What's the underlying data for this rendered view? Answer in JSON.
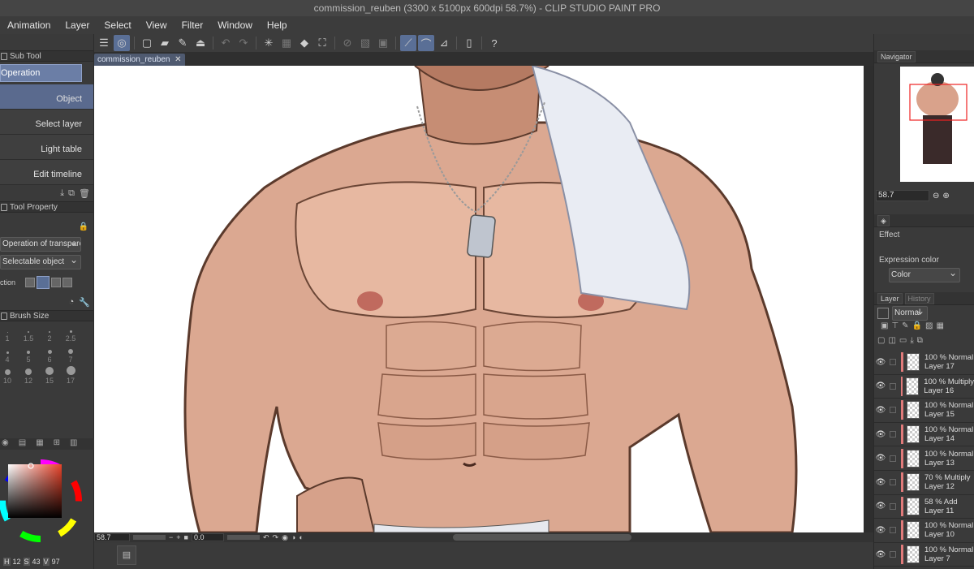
{
  "window": {
    "title": "commission_reuben (3300 x 5100px 600dpi 58.7%) - CLIP STUDIO PAINT PRO"
  },
  "menu": [
    "Animation",
    "Layer",
    "Select",
    "View",
    "Filter",
    "Window",
    "Help"
  ],
  "subtool": {
    "header": "Sub Tool",
    "group": "Operation",
    "items": [
      "Object",
      "Select layer",
      "Light table",
      "Edit timeline"
    ]
  },
  "tool_property": {
    "header": "Tool Property",
    "operation_select": "Operation of transparent part",
    "selectable": "Selectable object",
    "selection_label": "ction"
  },
  "brush_size": {
    "header": "Brush Size",
    "rows": [
      [
        "1",
        "1.5",
        "2",
        "2.5"
      ],
      [
        "4",
        "5",
        "6",
        "7"
      ],
      [
        "10",
        "12",
        "15",
        "17"
      ]
    ]
  },
  "color_values": {
    "h": "H",
    "h_val": "12",
    "s": "S",
    "s_val": "43",
    "v": "V",
    "v_val": "97"
  },
  "document_tab": {
    "label": "commission_reuben"
  },
  "status": {
    "zoom": "58.7",
    "angle": "0.0"
  },
  "navigator": {
    "header": "Navigator",
    "zoom": "58.7"
  },
  "layer_property": {
    "effect": "Effect",
    "expression_color": "Expression color",
    "color_mode": "Color"
  },
  "layer_panel": {
    "tab_layer": "Layer",
    "tab_history": "History",
    "blend_mode": "Normal",
    "layers": [
      {
        "mode": "100 % Normal",
        "name": "Layer 17"
      },
      {
        "mode": "100 % Multiply",
        "name": "Layer 16"
      },
      {
        "mode": "100 % Normal",
        "name": "Layer 15"
      },
      {
        "mode": "100 % Normal",
        "name": "Layer 14"
      },
      {
        "mode": "100 % Normal",
        "name": "Layer 13"
      },
      {
        "mode": "70 % Multiply",
        "name": "Layer 12"
      },
      {
        "mode": "58 % Add",
        "name": "Layer 11"
      },
      {
        "mode": "100 % Normal",
        "name": "Layer 10"
      },
      {
        "mode": "100 % Normal",
        "name": "Layer 7"
      }
    ]
  },
  "colors": {
    "accent": "#5a6f96",
    "layer_marker": "#e07a7a",
    "current_color": "#e8735a"
  }
}
